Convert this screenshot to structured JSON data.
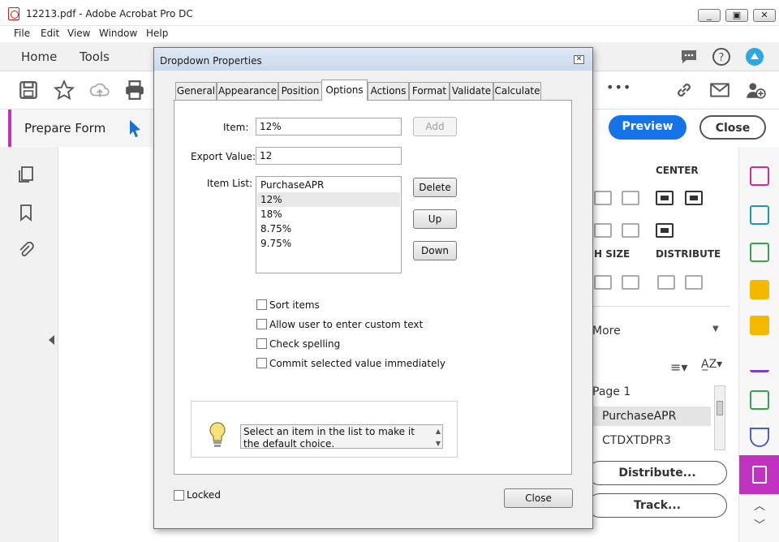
{
  "window": {
    "title": "12213.pdf - Adobe Acrobat Pro DC",
    "controls": {
      "minimize": "▭",
      "restore": "▣",
      "close": "✕"
    }
  },
  "menu": [
    "File",
    "Edit",
    "View",
    "Window",
    "Help"
  ],
  "app_tabs": {
    "home": "Home",
    "tools": "Tools"
  },
  "toolbar": {
    "more": "•••"
  },
  "prepare_form": {
    "label": "Prepare Form"
  },
  "right_panel": {
    "preview": "Preview",
    "close": "Close",
    "center_label": "CENTER",
    "size_label": "H SIZE",
    "distribute_label": "DISTRIBUTE",
    "more_label": "More",
    "page_label": "Page 1",
    "field_1": "PurchaseAPR",
    "field_2": "CTDXTDPR3",
    "distribute_btn": "Distribute...",
    "track_btn": "Track..."
  },
  "dialog": {
    "title": "Dropdown Properties",
    "tabs": [
      "General",
      "Appearance",
      "Position",
      "Options",
      "Actions",
      "Format",
      "Validate",
      "Calculate"
    ],
    "active_tab": "Options",
    "item_label": "Item:",
    "item_value": "12%",
    "add_button": "Add",
    "export_label": "Export Value:",
    "export_value": "12",
    "item_list_label": "Item List:",
    "item_list": [
      "PurchaseAPR",
      "12%",
      "18%",
      "8.75%",
      "9.75%"
    ],
    "selected_index": 1,
    "delete_button": "Delete",
    "up_button": "Up",
    "down_button": "Down",
    "checkboxes": [
      "Sort items",
      "Allow user to enter custom text",
      "Check spelling",
      "Commit selected value immediately"
    ],
    "hint": "Select an item in the list to make it the default choice.",
    "locked_label": "Locked",
    "close_button": "Close"
  },
  "colors": {
    "accent_blue": "#1473e6",
    "prepare_form_purple": "#c132c1",
    "dialog_title_gradient": "#c9d9ec"
  }
}
